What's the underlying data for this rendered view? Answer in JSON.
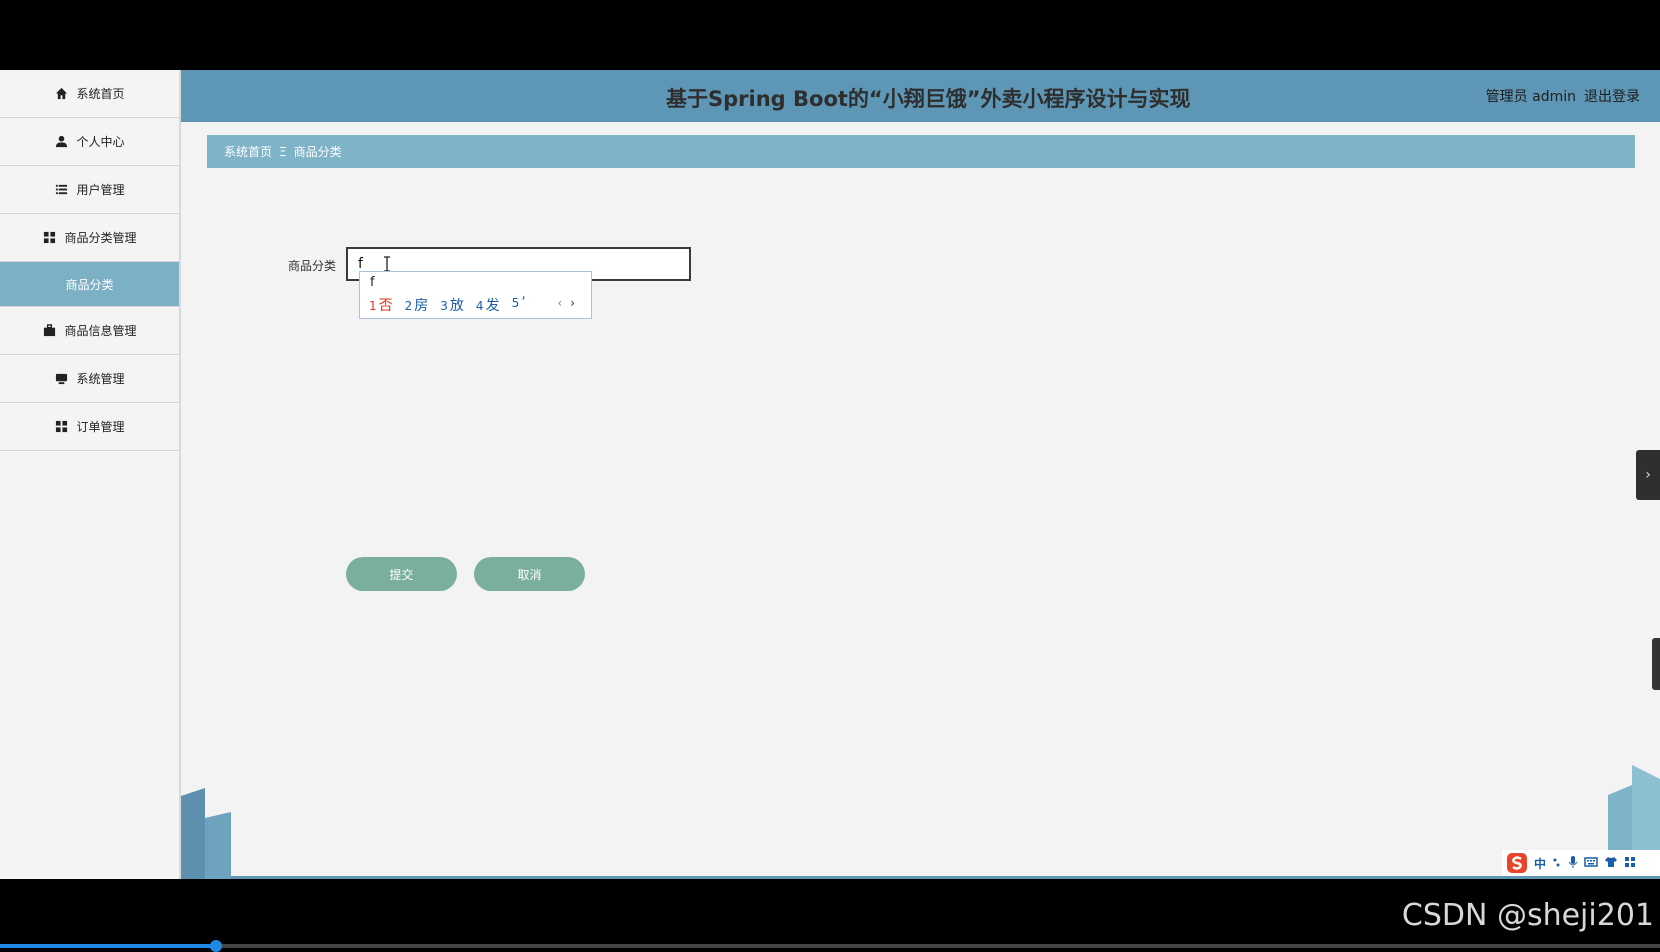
{
  "header": {
    "title": "基于Spring Boot的“小翔巨饿”外卖小程序设计与实现",
    "user_role": "管理员 admin",
    "logout": "退出登录"
  },
  "sidebar": {
    "items": [
      {
        "label": "系统首页",
        "icon": "home-icon"
      },
      {
        "label": "个人中心",
        "icon": "user-icon"
      },
      {
        "label": "用户管理",
        "icon": "list-icon"
      },
      {
        "label": "商品分类管理",
        "icon": "grid-icon"
      },
      {
        "label": "商品分类",
        "icon": ""
      },
      {
        "label": "商品信息管理",
        "icon": "briefcase-icon"
      },
      {
        "label": "系统管理",
        "icon": "monitor-icon"
      },
      {
        "label": "订单管理",
        "icon": "grid-icon"
      }
    ],
    "active_index": 4
  },
  "breadcrumb": {
    "home": "系统首页",
    "separator": "Ξ",
    "current": "商品分类"
  },
  "form": {
    "label": "商品分类",
    "value": "f"
  },
  "ime": {
    "composition": "f",
    "candidates": [
      {
        "num": "1",
        "char": "否"
      },
      {
        "num": "2",
        "char": "房"
      },
      {
        "num": "3",
        "char": "放"
      },
      {
        "num": "4",
        "char": "发"
      },
      {
        "num": "5",
        "char": "’"
      }
    ],
    "prev": "‹",
    "next": "›",
    "tray_mode": "中"
  },
  "buttons": {
    "submit": "提交",
    "cancel": "取消"
  },
  "drawer_toggle": "›",
  "watermark": "CSDN @sheji201",
  "video_progress": 0.13,
  "colors": {
    "header": "#5d97b5",
    "breadcrumb": "#7fb3c8",
    "active_sidebar": "#7cb0c4",
    "button": "#7aaf9e"
  }
}
